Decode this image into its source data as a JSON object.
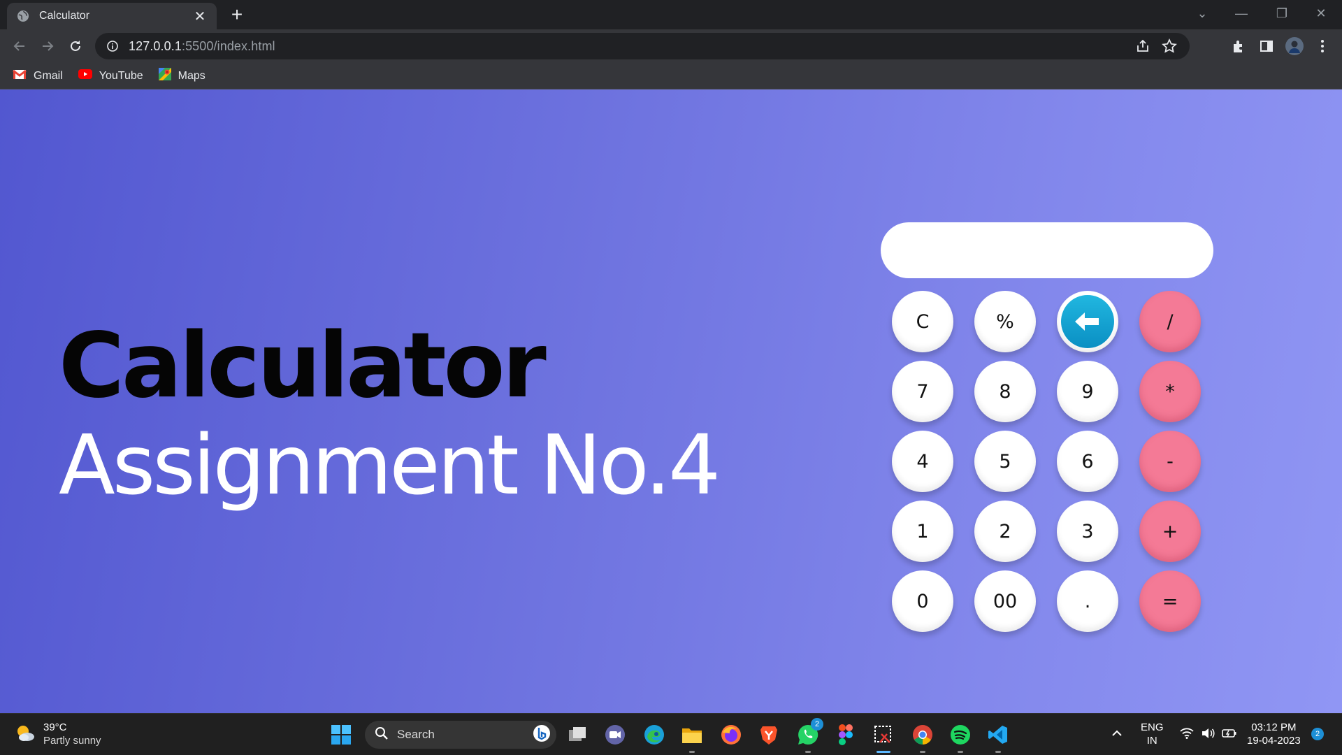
{
  "browser": {
    "tab_title": "Calculator",
    "url_host": "127.0.0.1",
    "url_rest": ":5500/index.html",
    "bookmarks": [
      {
        "label": "Gmail",
        "icon": "gmail-icon"
      },
      {
        "label": "YouTube",
        "icon": "youtube-icon"
      },
      {
        "label": "Maps",
        "icon": "maps-icon"
      }
    ]
  },
  "page": {
    "headline": "Calculator",
    "subline": "Assignment No.4"
  },
  "calculator": {
    "display_value": "",
    "keys": [
      {
        "label": "C",
        "kind": "clear"
      },
      {
        "label": "%",
        "kind": "number"
      },
      {
        "label": "",
        "kind": "backspace",
        "icon": "backspace-arrow-icon"
      },
      {
        "label": "/",
        "kind": "operator"
      },
      {
        "label": "7",
        "kind": "number"
      },
      {
        "label": "8",
        "kind": "number"
      },
      {
        "label": "9",
        "kind": "number"
      },
      {
        "label": "*",
        "kind": "operator"
      },
      {
        "label": "4",
        "kind": "number"
      },
      {
        "label": "5",
        "kind": "number"
      },
      {
        "label": "6",
        "kind": "number"
      },
      {
        "label": "-",
        "kind": "operator"
      },
      {
        "label": "1",
        "kind": "number"
      },
      {
        "label": "2",
        "kind": "number"
      },
      {
        "label": "3",
        "kind": "number"
      },
      {
        "label": "+",
        "kind": "operator"
      },
      {
        "label": "0",
        "kind": "number"
      },
      {
        "label": "00",
        "kind": "number"
      },
      {
        "label": ".",
        "kind": "number"
      },
      {
        "label": "=",
        "kind": "operator"
      }
    ],
    "colors": {
      "operator": "#f47a96",
      "number": "#ffffff",
      "backspace": "#0a8fc3"
    }
  },
  "taskbar": {
    "weather_temp": "39°C",
    "weather_condition": "Partly sunny",
    "search_label": "Search",
    "lang_top": "ENG",
    "lang_bottom": "IN",
    "time": "03:12 PM",
    "date": "19-04-2023",
    "notification_count": "2",
    "whatsapp_badge": "2",
    "apps": [
      "windows-start-icon",
      "task-view-icon",
      "meet-icon",
      "edge-icon",
      "file-explorer-icon",
      "firefox-icon",
      "brave-icon",
      "whatsapp-icon",
      "figma-icon",
      "snipping-tool-icon",
      "chrome-icon",
      "spotify-icon",
      "vscode-icon"
    ]
  },
  "colors": {
    "page_gradient_start": "#5257d0",
    "page_gradient_end": "#9096f4",
    "chrome_dark": "#202124",
    "chrome_toolbar": "#35363a"
  }
}
